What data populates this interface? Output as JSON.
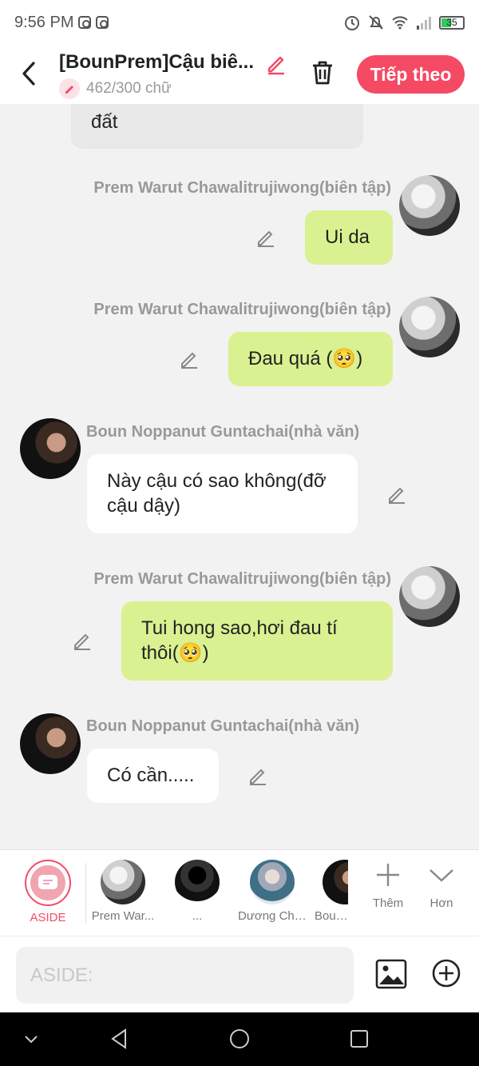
{
  "status_bar": {
    "time": "9:56 PM",
    "battery": "35"
  },
  "header": {
    "title": "[BounPrem]Cậu biê...",
    "word_count": "462/300 chữ",
    "next_label": "Tiếp theo"
  },
  "messages": {
    "partial_text": "đất",
    "m1": {
      "name": "Prem Warut Chawalitrujiwong(biên tập)",
      "text": "Ui da"
    },
    "m2": {
      "name": "Prem Warut Chawalitrujiwong(biên tập)",
      "text": "Đau quá (🥺)"
    },
    "m3": {
      "name": "Boun Noppanut Guntachai(nhà văn)",
      "text": "Này cậu có sao không(đỡ cậu dậy)"
    },
    "m4": {
      "name": "Prem Warut Chawalitrujiwong(biên tập)",
      "text": "Tui hong sao,hơi đau tí thôi(🥺)"
    },
    "m5": {
      "name": "Boun Noppanut Guntachai(nhà văn)",
      "text": "Có cần....."
    }
  },
  "characters": {
    "aside": "ASIDE",
    "c1": "Prem War...",
    "c2": "...",
    "c3": "Dương Chí...",
    "c4": "Boun N",
    "add": "Thêm",
    "more": "Hơn"
  },
  "input": {
    "placeholder": "ASIDE:"
  },
  "colors": {
    "accent": "#f54a64",
    "bubble_green": "#d9f191",
    "bubble_white": "#ffffff"
  }
}
